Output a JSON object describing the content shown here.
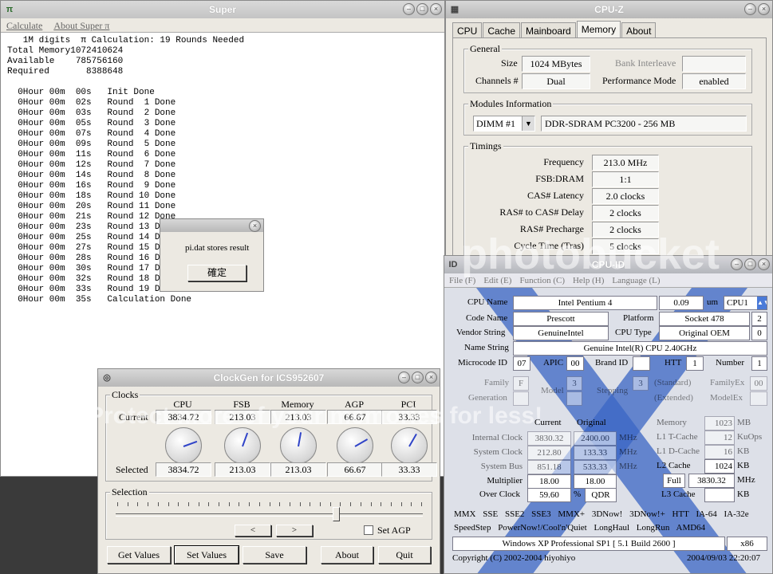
{
  "superpi": {
    "title": "Super",
    "menu": {
      "calculate": "Calculate",
      "about": "About Super π"
    },
    "output_lines": [
      "   1M digits  π Calculation: 19 Rounds Needed",
      "Total Memory1072410624",
      "Available    785756160",
      "Required       8388648",
      "",
      "  0Hour 00m  00s   Init Done",
      "  0Hour 00m  02s   Round  1 Done",
      "  0Hour 00m  03s   Round  2 Done",
      "  0Hour 00m  05s   Round  3 Done",
      "  0Hour 00m  07s   Round  4 Done",
      "  0Hour 00m  09s   Round  5 Done",
      "  0Hour 00m  11s   Round  6 Done",
      "  0Hour 00m  12s   Round  7 Done",
      "  0Hour 00m  14s   Round  8 Done",
      "  0Hour 00m  16s   Round  9 Done",
      "  0Hour 00m  18s   Round 10 Done",
      "  0Hour 00m  20s   Round 11 Done",
      "  0Hour 00m  21s   Round 12 Done",
      "  0Hour 00m  23s   Round 13 Done",
      "  0Hour 00m  25s   Round 14 Done",
      "  0Hour 00m  27s   Round 15 Done",
      "  0Hour 00m  28s   Round 16 Done",
      "  0Hour 00m  30s   Round 17 Done",
      "  0Hour 00m  32s   Round 18 Done",
      "  0Hour 00m  33s   Round 19 Done",
      "  0Hour 00m  35s   Calculation Done"
    ],
    "dialog": {
      "message": "pi.dat stores result",
      "ok_label": "確定"
    }
  },
  "cpuz": {
    "title": "CPU-Z",
    "tabs": [
      "CPU",
      "Cache",
      "Mainboard",
      "Memory",
      "About"
    ],
    "active_tab": "Memory",
    "general": {
      "group": "General",
      "size_label": "Size",
      "size": "1024 MBytes",
      "bank_label": "Bank Interleave",
      "bank": "",
      "channels_label": "Channels #",
      "channels": "Dual",
      "perf_label": "Performance Mode",
      "perf": "enabled"
    },
    "modules": {
      "group": "Modules Information",
      "slot": "DIMM #1",
      "desc": "DDR-SDRAM PC3200 - 256 MB"
    },
    "timings": {
      "group": "Timings",
      "rows": [
        {
          "label": "Frequency",
          "value": "213.0 MHz"
        },
        {
          "label": "FSB:DRAM",
          "value": "1:1"
        },
        {
          "label": "CAS# Latency",
          "value": "2.0 clocks"
        },
        {
          "label": "RAS# to CAS# Delay",
          "value": "2 clocks"
        },
        {
          "label": "RAS# Precharge",
          "value": "2 clocks"
        },
        {
          "label": "Cycle Time (Tras)",
          "value": "5 clocks"
        }
      ]
    }
  },
  "cpuid": {
    "title": "CPU-ID",
    "menu": [
      "File (F)",
      "Edit (E)",
      "Function (C)",
      "Help (H)",
      "Language (L)"
    ],
    "cpu_name_label": "CPU Name",
    "cpu_name": "Intel Pentium 4",
    "process": "0.09",
    "process_unit": "um",
    "cpu_select": "CPU1",
    "code_name_label": "Code Name",
    "code_name": "Prescott",
    "platform_label": "Platform",
    "platform": "Socket 478",
    "platform_count": "2",
    "vendor_label": "Vendor String",
    "vendor": "GenuineIntel",
    "cpu_type_label": "CPU Type",
    "cpu_type": "Original OEM",
    "cpu_type_num": "0",
    "name_string_label": "Name String",
    "name_string": "Genuine Intel(R) CPU 2.40GHz",
    "microcode_label": "Microcode ID",
    "microcode": "07",
    "apic_label": "APIC",
    "apic": "00",
    "brand_label": "Brand ID",
    "brand": "",
    "htt_label": "HTT",
    "htt": "1",
    "number_label": "Number",
    "number": "1",
    "family_label": "Family",
    "family": "F",
    "generation_label": "Generation",
    "model_label": "Model",
    "model": "3",
    "stepping_label": "Stepping",
    "stepping": "3",
    "standard_label": "(Standard)",
    "extended_label": "(Extended)",
    "familyex_label": "FamilyEx",
    "familyex": "00",
    "modelex_label": "ModelEx",
    "current_hdr": "Current",
    "original_hdr": "Original",
    "clock_rows": [
      {
        "label": "Internal Clock",
        "current": "3830.32",
        "original": "2400.00",
        "unit": "MHz"
      },
      {
        "label": "System Clock",
        "current": "212.80",
        "original": "133.33",
        "unit": "MHz"
      },
      {
        "label": "System Bus",
        "current": "851.18",
        "original": "533.33",
        "unit": "MHz"
      },
      {
        "label": "Multiplier",
        "current": "18.00",
        "original": "18.00",
        "unit": ""
      }
    ],
    "overclock_label": "Over Clock",
    "overclock": "59.60",
    "overclock_unit": "%",
    "qdr": "QDR",
    "cache_rows": [
      {
        "label": "Memory",
        "value": "1023",
        "unit": "MB"
      },
      {
        "label": "L1 T-Cache",
        "value": "12",
        "unit": "KuOps"
      },
      {
        "label": "L1 D-Cache",
        "value": "16",
        "unit": "KB"
      },
      {
        "label": "L2 Cache",
        "value": "1024",
        "unit": "KB"
      }
    ],
    "full_label": "Full",
    "full_value": "3830.32",
    "full_unit": "MHz",
    "l3_label": "L3 Cache",
    "l3_unit": "KB",
    "flags1": "MMX  SSE  SSE2  SSE3  MMX+  3DNow!  3DNow!+  HTT  IA-64  IA-32e",
    "flags2": "SpeedStep   PowerNow!/Cool'n'Quiet   LongHaul   LongRun   AMD64",
    "os": "Windows XP Professional SP1 [ 5.1 Build 2600 ]",
    "arch": "x86",
    "copyright": "Copyright (C) 2002-2004 hiyohiyo",
    "date": "2004/09/03 22:20:07"
  },
  "clockgen": {
    "title": "ClockGen for ICS952607",
    "clocks_group": "Clocks",
    "columns": [
      "CPU",
      "FSB",
      "Memory",
      "AGP",
      "PCI"
    ],
    "current_label": "Current",
    "current": [
      "3834.72",
      "213.03",
      "213.03",
      "66.67",
      "33.33"
    ],
    "selected_label": "Selected",
    "selected": [
      "3834.72",
      "213.03",
      "213.03",
      "66.67",
      "33.33"
    ],
    "selection_group": "Selection",
    "prev_btn": "<",
    "next_btn": ">",
    "set_agp_label": "Set AGP",
    "buttons": {
      "get": "Get Values",
      "set": "Set Values",
      "save": "Save",
      "about": "About",
      "quit": "Quit"
    }
  },
  "watermark": {
    "brand": "photobucket",
    "tagline": "Protect more of your memories for less!"
  }
}
